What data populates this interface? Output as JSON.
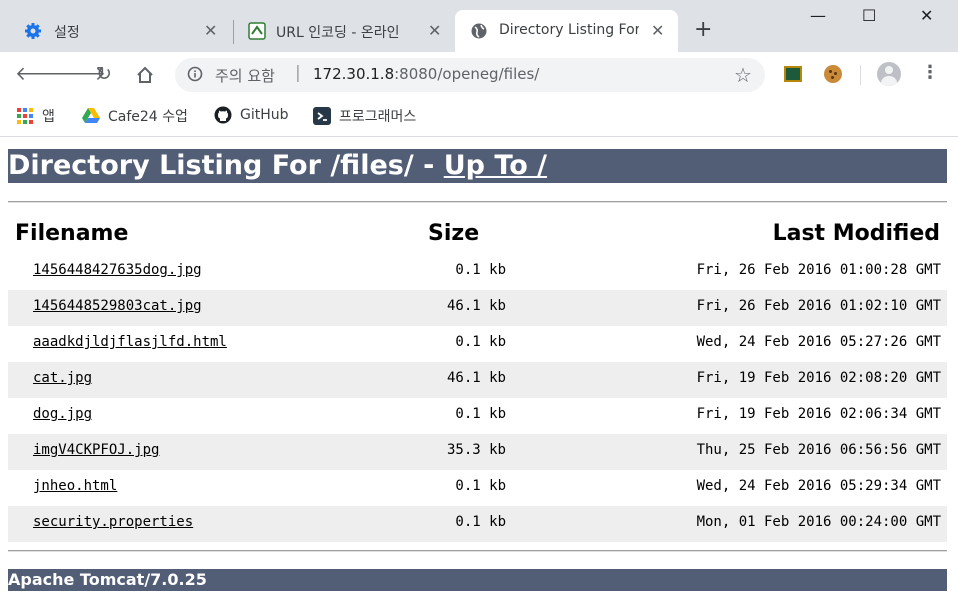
{
  "tabs": [
    {
      "label": "설정",
      "icon": "gear-icon"
    },
    {
      "label": "URL 인코딩 - 온라인",
      "icon": "url-encode-icon"
    },
    {
      "label": "Directory Listing For",
      "icon": "globe-icon"
    }
  ],
  "window": {
    "minimize": "—",
    "maximize": "☐",
    "close": "✕"
  },
  "omnibox": {
    "security_label": "주의 요함",
    "url_host": "172.30.1.8",
    "url_rest": ":8080/openeg/files/"
  },
  "bookmarks": [
    {
      "label": "앱",
      "icon": "apps-grid-icon"
    },
    {
      "label": "Cafe24 수업",
      "icon": "google-drive-icon"
    },
    {
      "label": "GitHub",
      "icon": "github-icon"
    },
    {
      "label": "프로그래머스",
      "icon": "programmers-icon"
    }
  ],
  "listing": {
    "title_prefix": "Directory Listing For /files/ - ",
    "up_link": "Up To /",
    "headers": {
      "name": "Filename",
      "size": "Size",
      "modified": "Last Modified"
    },
    "files": [
      {
        "name": "1456448427635dog.jpg",
        "size": "0.1 kb",
        "modified": "Fri, 26 Feb 2016 01:00:28 GMT"
      },
      {
        "name": "1456448529803cat.jpg",
        "size": "46.1 kb",
        "modified": "Fri, 26 Feb 2016 01:02:10 GMT"
      },
      {
        "name": "aaadkdjldjflasjlfd.html",
        "size": "0.1 kb",
        "modified": "Wed, 24 Feb 2016 05:27:26 GMT"
      },
      {
        "name": "cat.jpg",
        "size": "46.1 kb",
        "modified": "Fri, 19 Feb 2016 02:08:20 GMT"
      },
      {
        "name": "dog.jpg",
        "size": "0.1 kb",
        "modified": "Fri, 19 Feb 2016 02:06:34 GMT"
      },
      {
        "name": "imgV4CKPFOJ.jpg",
        "size": "35.3 kb",
        "modified": "Thu, 25 Feb 2016 06:56:56 GMT"
      },
      {
        "name": "jnheo.html",
        "size": "0.1 kb",
        "modified": "Wed, 24 Feb 2016 05:29:34 GMT"
      },
      {
        "name": "security.properties",
        "size": "0.1 kb",
        "modified": "Mon, 01 Feb 2016 00:24:00 GMT"
      }
    ],
    "footer": "Apache Tomcat/7.0.25"
  },
  "colors": {
    "tomcat_header": "#525d76",
    "row_stripe": "#eeeeee",
    "tab_bar": "#dee1e6"
  }
}
